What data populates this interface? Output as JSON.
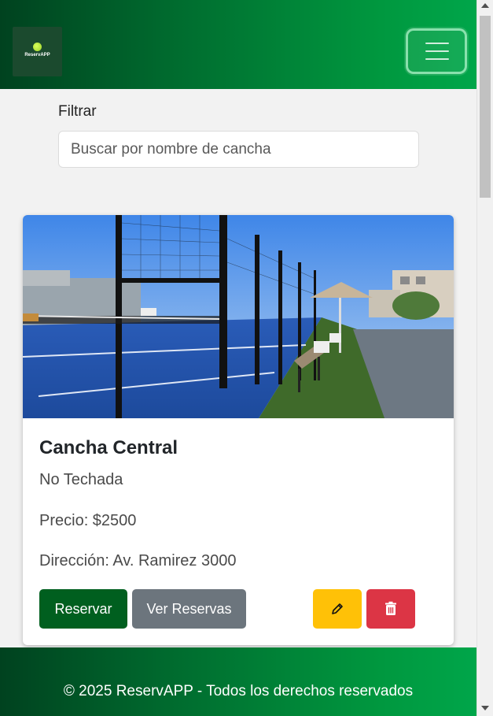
{
  "brand": {
    "logo_text": "ReservAPP"
  },
  "filter": {
    "label": "Filtrar",
    "placeholder": "Buscar por nombre de cancha",
    "value": ""
  },
  "card": {
    "title": "Cancha Central",
    "type": "No Techada",
    "price": "Precio: $2500",
    "address": "Dirección: Av. Ramirez 3000",
    "buttons": {
      "reserve": "Reservar",
      "view_reservations": "Ver Reservas",
      "edit_icon": "pencil-icon",
      "delete_icon": "trash-icon"
    }
  },
  "footer": {
    "text": "© 2025 ReservAPP - Todos los derechos reservados"
  },
  "colors": {
    "primary_green": "#005f1f",
    "secondary": "#6c757d",
    "warning": "#ffc107",
    "danger": "#dc3545"
  }
}
